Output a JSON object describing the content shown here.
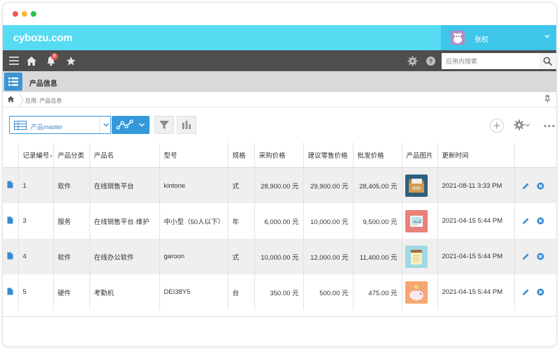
{
  "window": {
    "colors": {
      "close": "#f25a55",
      "minimize": "#f7b835",
      "maximize": "#27c24a"
    }
  },
  "header": {
    "logo": "cybozu.com",
    "user_name": "张权",
    "colors": {
      "bar": "#57dbf3",
      "user_box": "#3ec6ea"
    }
  },
  "toolbar": {
    "notification_count": "8",
    "search_placeholder": "应用内搜索",
    "icons": [
      "menu-icon",
      "home-icon",
      "bell-icon",
      "star-icon",
      "gear-icon",
      "help-icon",
      "search-icon"
    ]
  },
  "app": {
    "name": "产品信息",
    "breadcrumb": "应用: 产品信息"
  },
  "view": {
    "selected_view": "产品master"
  },
  "table": {
    "headers": [
      "记录编号",
      "产品分类",
      "产品名",
      "型号",
      "规格",
      "采购价格",
      "建议零售价格",
      "批发价格",
      "产品图片",
      "更新时间"
    ],
    "rows": [
      {
        "id": "1",
        "category": "软件",
        "name": "在线销售平台",
        "model": "kintone",
        "spec": "式",
        "purchase": "28,900.00 元",
        "retail": "29,900.00 元",
        "wholesale": "28,405.00 元",
        "image": "folder-file-thumbnail",
        "updated": "2021-08-11 3:33 PM"
      },
      {
        "id": "3",
        "category": "服务",
        "name": "在线销售平台·维护",
        "model": "中小型（50人以下）",
        "spec": "年",
        "purchase": "6,000.00 元",
        "retail": "10,000.00 元",
        "wholesale": "9,500.00 元",
        "image": "picture-card-thumbnail",
        "updated": "2021-04-15 5:44 PM"
      },
      {
        "id": "4",
        "category": "软件",
        "name": "在线办公软件",
        "model": "garoon",
        "spec": "式",
        "purchase": "10,000.00 元",
        "retail": "12,000.00 元",
        "wholesale": "11,400.00 元",
        "image": "notepad-thumbnail",
        "updated": "2021-04-15 5:44 PM"
      },
      {
        "id": "5",
        "category": "硬件",
        "name": "考勤机",
        "model": "DEI38Y5",
        "spec": "台",
        "purchase": "350.00 元",
        "retail": "500.00 元",
        "wholesale": "475.00 元",
        "image": "piggy-bank-thumbnail",
        "updated": "2021-04-15 5:44 PM"
      }
    ]
  },
  "accent_color": "#3498db"
}
